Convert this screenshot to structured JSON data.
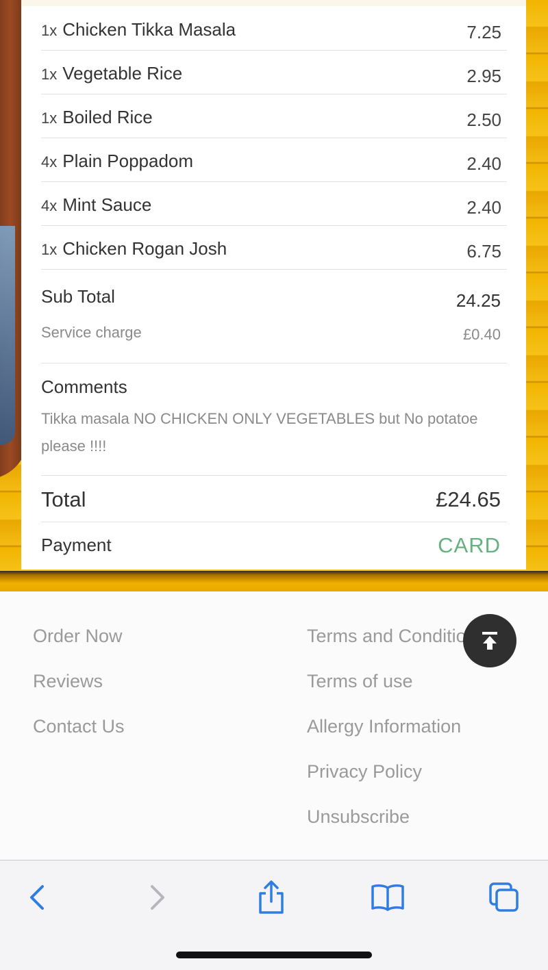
{
  "order": {
    "items": [
      {
        "qty": "1x",
        "name": "Chicken Tikka Masala",
        "price": "7.25"
      },
      {
        "qty": "1x",
        "name": "Vegetable Rice",
        "price": "2.95"
      },
      {
        "qty": "1x",
        "name": "Boiled Rice",
        "price": "2.50"
      },
      {
        "qty": "4x",
        "name": "Plain Poppadom",
        "price": "2.40"
      },
      {
        "qty": "4x",
        "name": "Mint Sauce",
        "price": "2.40"
      },
      {
        "qty": "1x",
        "name": "Chicken Rogan Josh",
        "price": "6.75"
      }
    ],
    "subtotal_label": "Sub Total",
    "subtotal_value": "24.25",
    "service_label": "Service charge",
    "service_value": "£0.40",
    "comments_label": "Comments",
    "comments_text": "Tikka masala NO CHICKEN ONLY VEGETABLES but No potatoe please !!!!",
    "total_label": "Total",
    "total_value": "£24.65",
    "payment_label": "Payment",
    "payment_value": "CARD"
  },
  "footer": {
    "left_links": [
      "Order Now",
      "Reviews",
      "Contact Us"
    ],
    "right_links": [
      "Terms and Conditio",
      "Terms of use",
      "Allergy Information",
      "Privacy Policy",
      "Unsubscribe"
    ]
  },
  "toolbar": {
    "icons": [
      "back-icon",
      "forward-icon",
      "share-icon",
      "bookmarks-icon",
      "tabs-icon"
    ],
    "accent_color": "#2f7de1"
  },
  "colors": {
    "payment_accent": "#66b17f",
    "background_yellow": "#f2b500"
  }
}
